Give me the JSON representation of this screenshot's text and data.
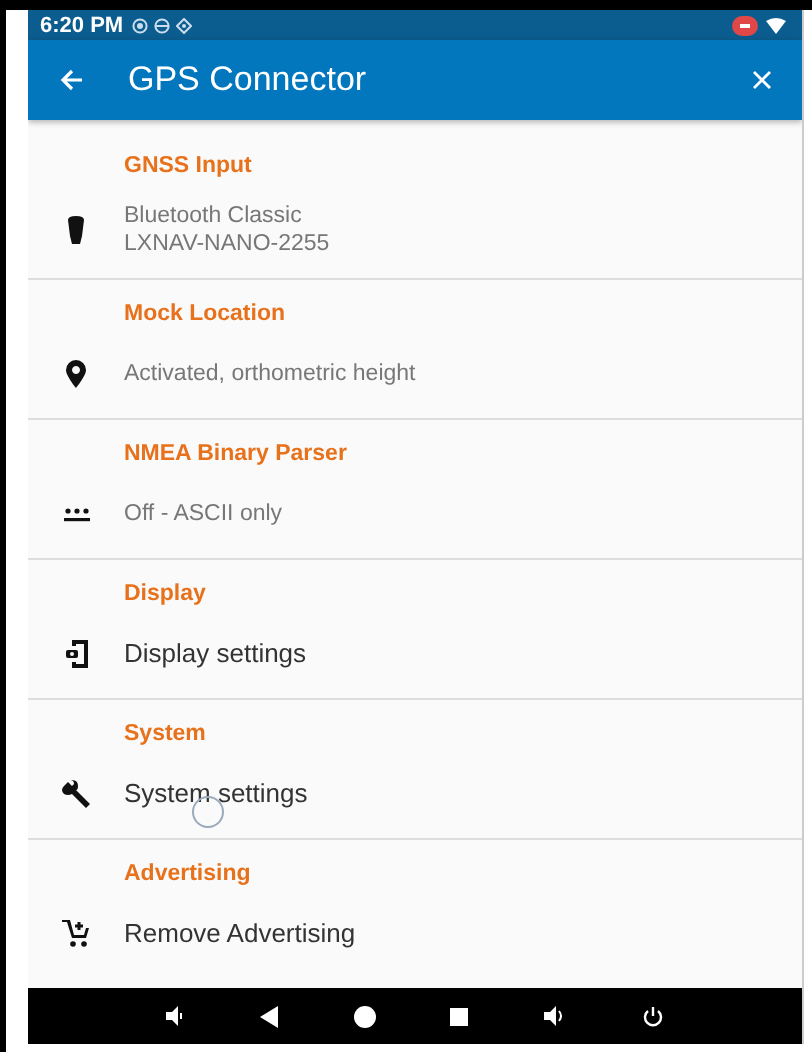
{
  "status_bar": {
    "time": "6:20 PM"
  },
  "toolbar": {
    "title": "GPS Connector"
  },
  "sections": [
    {
      "header": "GNSS Input",
      "item": {
        "kind": "summary",
        "lines": [
          "Bluetooth Classic",
          "LXNAV-NANO-2255"
        ]
      }
    },
    {
      "header": "Mock Location",
      "item": {
        "kind": "summary",
        "lines": [
          "Activated, orthometric height"
        ]
      }
    },
    {
      "header": "NMEA Binary Parser",
      "item": {
        "kind": "summary",
        "lines": [
          "Off - ASCII only"
        ]
      }
    },
    {
      "header": "Display",
      "item": {
        "kind": "action",
        "lines": [
          "Display settings"
        ]
      }
    },
    {
      "header": "System",
      "item": {
        "kind": "action",
        "lines": [
          "System settings"
        ]
      }
    },
    {
      "header": "Advertising",
      "item": {
        "kind": "action",
        "lines": [
          "Remove Advertising"
        ]
      }
    }
  ]
}
